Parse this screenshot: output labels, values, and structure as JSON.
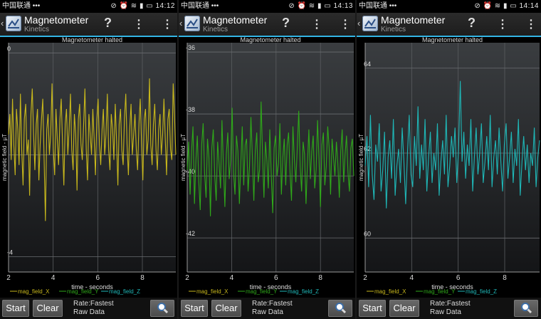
{
  "screens": [
    {
      "status": {
        "carrier": "中国联通 •••",
        "icons": "⊘ ⏰ ≋ ▮ ▭",
        "time": "14:12"
      },
      "app": {
        "title": "Magnetometer",
        "subtitle": "Kinetics"
      },
      "chart_title": "Magnetometer halted",
      "legend": [
        "mag_field_X",
        "mag_field_Y",
        "mag_field_Z"
      ],
      "controls": {
        "start": "Start",
        "clear": "Clear",
        "rate": "Rate:Fastest",
        "data": "Raw Data"
      }
    },
    {
      "status": {
        "carrier": "中国联通 •••",
        "icons": "⊘ ⏰ ≋ ▮ ▭",
        "time": "14:13"
      },
      "app": {
        "title": "Magnetometer",
        "subtitle": "Kinetics"
      },
      "chart_title": "Magnetometer halted",
      "legend": [
        "mag_field_X",
        "mag_field_Y",
        "mag_field_Z"
      ],
      "controls": {
        "start": "Start",
        "clear": "Clear",
        "rate": "Rate:Fastest",
        "data": "Raw Data"
      }
    },
    {
      "status": {
        "carrier": "中国联通 •••",
        "icons": "⊘ ⏰ ≋ ▮ ▭",
        "time": "14:14"
      },
      "app": {
        "title": "Magnetometer",
        "subtitle": "Kinetics"
      },
      "chart_title": "Magnetometer halted",
      "legend": [
        "mag_field_X",
        "mag_field_Y",
        "mag_field_Z"
      ],
      "controls": {
        "start": "Start",
        "clear": "Clear",
        "rate": "Rate:Fastest",
        "data": "Raw Data"
      }
    }
  ],
  "colors": {
    "x": "#c8b81c",
    "y": "#2fa81a",
    "z": "#1fb7b7",
    "accent": "#33b5e5"
  },
  "chart_data": [
    {
      "type": "line",
      "title": "Magnetometer halted",
      "xlabel": "time - seconds",
      "ylabel": "magnetic field - µT",
      "xlim": [
        2,
        9.5
      ],
      "ylim": [
        -4.3,
        0.2
      ],
      "xticks": [
        2,
        4,
        6,
        8
      ],
      "yticks": [
        0,
        -2,
        -4
      ],
      "ytick_labels": [
        "0",
        "",
        "-4"
      ],
      "series": [
        {
          "name": "mag_field_X",
          "color": "#c8b81c",
          "values": [
            -1.6,
            -1.2,
            -2.1,
            -0.9,
            -1.8,
            -2.4,
            -1.1,
            -1.5,
            -2.2,
            -0.8,
            -1.9,
            -2.6,
            -1.3,
            -1.0,
            -2.0,
            -1.7,
            -2.8,
            -1.2,
            -0.7,
            -1.6,
            -2.3,
            -1.4,
            -1.1,
            -2.5,
            -1.8,
            -1.3,
            -0.9,
            -2.1,
            -3.3,
            -1.5,
            -1.2,
            -2.0,
            -1.6,
            -0.6,
            -1.9,
            -2.4,
            -1.1,
            -1.7,
            -2.2,
            -1.3,
            -0.9,
            -1.8,
            -2.6,
            -1.4,
            -1.1,
            -2.0,
            -1.5,
            -0.8,
            -1.9,
            -2.3,
            -1.2,
            -1.6,
            -2.7,
            -1.3,
            -1.0,
            -1.8,
            -2.1,
            -1.4,
            -0.7,
            -1.9,
            -2.5,
            -1.2,
            -1.6,
            -2.0,
            -1.1,
            -1.7,
            -2.4,
            -1.3,
            -0.9,
            -1.8,
            -2.2,
            -1.5,
            -1.1,
            -2.0,
            -1.6,
            -0.8,
            -1.9,
            -2.3,
            -1.2,
            -1.5,
            -2.1,
            -1.0,
            -1.7,
            -2.6,
            -1.4,
            -1.1,
            -1.9,
            -2.2,
            -1.3,
            -0.8,
            -1.8,
            -2.4,
            -1.5,
            -1.0,
            -2.0,
            -1.6,
            -1.2,
            -1.9,
            -2.3,
            -1.4,
            -0.9,
            -1.8,
            -2.5,
            -1.3,
            -1.1,
            -2.0,
            -1.7,
            -0.5,
            -1.8,
            -2.2,
            -1.4,
            -1.0,
            -1.9,
            -2.3,
            -1.5,
            -1.2,
            -2.0,
            -1.6,
            -0.9,
            -1.7,
            -2.4,
            -1.3,
            -1.1,
            -1.9,
            -2.1,
            -0.6,
            -1.2,
            -2.0
          ]
        }
      ]
    },
    {
      "type": "line",
      "title": "Magnetometer halted",
      "xlabel": "time - seconds",
      "ylabel": "magnetic field - µT",
      "xlim": [
        2,
        9.5
      ],
      "ylim": [
        -43.1,
        -35.7
      ],
      "xticks": [
        2,
        4,
        6,
        8
      ],
      "yticks": [
        -36,
        -38,
        -40,
        -42
      ],
      "series": [
        {
          "name": "mag_field_Y",
          "color": "#2fa81a",
          "values": [
            -39.8,
            -38.9,
            -40.6,
            -39.2,
            -38.4,
            -40.9,
            -39.5,
            -38.7,
            -40.2,
            -41.1,
            -39.0,
            -38.3,
            -39.9,
            -40.7,
            -38.8,
            -39.4,
            -41.3,
            -39.1,
            -38.5,
            -40.0,
            -40.8,
            -38.9,
            -39.6,
            -40.4,
            -38.2,
            -39.7,
            -41.0,
            -39.3,
            -38.6,
            -40.1,
            -39.5,
            -37.8,
            -39.9,
            -40.6,
            -38.7,
            -39.2,
            -40.9,
            -39.6,
            -38.4,
            -40.3,
            -39.0,
            -38.8,
            -40.5,
            -39.7,
            -38.1,
            -39.4,
            -40.8,
            -39.2,
            -38.6,
            -40.2,
            -39.8,
            -37.6,
            -39.3,
            -40.7,
            -38.9,
            -39.5,
            -40.4,
            -38.5,
            -39.9,
            -41.2,
            -39.1,
            -38.7,
            -40.0,
            -39.6,
            -38.3,
            -40.6,
            -39.4,
            -38.8,
            -40.3,
            -39.0,
            -38.6,
            -39.9,
            -40.8,
            -38.4,
            -39.5,
            -40.2,
            -39.1,
            -37.9,
            -39.7,
            -40.5,
            -38.9,
            -39.3,
            -40.9,
            -39.6,
            -38.5,
            -40.1,
            -39.2,
            -38.7,
            -40.4,
            -39.8,
            -38.2,
            -39.5,
            -41.0,
            -39.0,
            -38.6,
            -40.3,
            -39.7,
            -38.4,
            -39.1,
            -40.6,
            -38.8,
            -39.4,
            -40.0,
            -38.9,
            -39.6,
            -40.7,
            -39.2,
            -38.5,
            -40.2,
            -39.3,
            -38.7,
            -39.9,
            -40.5,
            -39.1,
            -38.8,
            -40.0
          ]
        }
      ]
    },
    {
      "type": "line",
      "title": "Magnetometer halted",
      "xlabel": "time - seconds",
      "ylabel": "magnetic field - µT",
      "xlim": [
        2,
        9.5
      ],
      "ylim": [
        59.2,
        64.6
      ],
      "xticks": [
        2,
        4,
        6,
        8
      ],
      "yticks": [
        64,
        62,
        60
      ],
      "series": [
        {
          "name": "mag_field_Z",
          "color": "#1fb7b7",
          "values": [
            61.7,
            62.4,
            61.2,
            62.9,
            61.5,
            60.9,
            62.2,
            61.8,
            62.7,
            61.1,
            61.6,
            62.5,
            60.7,
            61.9,
            62.3,
            61.4,
            62.8,
            61.0,
            61.7,
            62.1,
            61.3,
            62.6,
            61.8,
            60.8,
            62.0,
            62.9,
            61.5,
            61.2,
            62.4,
            61.7,
            63.1,
            61.4,
            62.2,
            61.6,
            62.8,
            61.1,
            61.9,
            62.5,
            61.3,
            62.0,
            61.6,
            62.7,
            61.0,
            61.8,
            62.3,
            61.5,
            62.9,
            61.2,
            61.7,
            62.4,
            61.9,
            62.6,
            61.3,
            62.1,
            63.7,
            61.8,
            62.5,
            61.4,
            62.2,
            61.7,
            62.8,
            61.1,
            61.9,
            62.6,
            61.5,
            62.0,
            62.7,
            61.3,
            61.8,
            62.4,
            61.6,
            62.9,
            61.2,
            61.9,
            62.3,
            61.5,
            62.6,
            61.8,
            61.1,
            62.2,
            62.7,
            61.4,
            61.9,
            62.5,
            61.3,
            62.1,
            61.7,
            62.8,
            61.0,
            61.8,
            62.4,
            61.6,
            62.2,
            61.3,
            62.0,
            61.7,
            62.6,
            61.2,
            61.9,
            62.3
          ]
        }
      ]
    }
  ]
}
